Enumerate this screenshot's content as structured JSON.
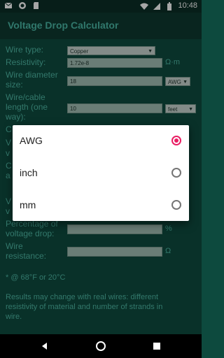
{
  "status_bar": {
    "time": "10:48",
    "left_icons": [
      "mail-icon",
      "circle-app-icon",
      "sd-card-icon"
    ],
    "right_icons": [
      "wifi-icon",
      "cell-signal-icon",
      "battery-icon"
    ]
  },
  "app_bar": {
    "title": "Voltage Drop Calculator"
  },
  "form": {
    "wire_type": {
      "label": "Wire type:",
      "value": "Copper"
    },
    "resistivity": {
      "label": "Resistivity:",
      "value": "1.72e-8",
      "unit": "Ω·m"
    },
    "wire_diameter": {
      "label_line1": "Wire diameter",
      "label_line2": "size:",
      "value": "18",
      "unit_select": "AWG"
    },
    "length": {
      "label_line1": "Wire/cable",
      "label_line2": "length (one",
      "label_line3": "way):",
      "value": "10",
      "unit_select": "feet"
    },
    "peek_labels": [
      "C",
      "V",
      "v",
      "C",
      "a"
    ],
    "voltage_drop_peek": {
      "line1": "V",
      "line2": "v"
    },
    "percentage": {
      "label_line1": "Percentage of",
      "label_line2": "voltage drop:",
      "value": "",
      "unit": "%"
    },
    "resistance": {
      "label_line1": "Wire",
      "label_line2": "resistance:",
      "value": "",
      "unit": "Ω"
    }
  },
  "notes": {
    "temperature": "* @ 68°F or 20°C",
    "disclaimer_line1": "Results may change with real wires: different",
    "disclaimer_line2": "resistivity of material and number of strands in",
    "disclaimer_line3": "wire."
  },
  "dialog": {
    "options": [
      {
        "label": "AWG",
        "selected": true
      },
      {
        "label": "inch",
        "selected": false
      },
      {
        "label": "mm",
        "selected": false
      }
    ]
  },
  "colors": {
    "accent": "#e91e63",
    "background": "#0e4c40",
    "text_teal": "#4fb9a5"
  }
}
